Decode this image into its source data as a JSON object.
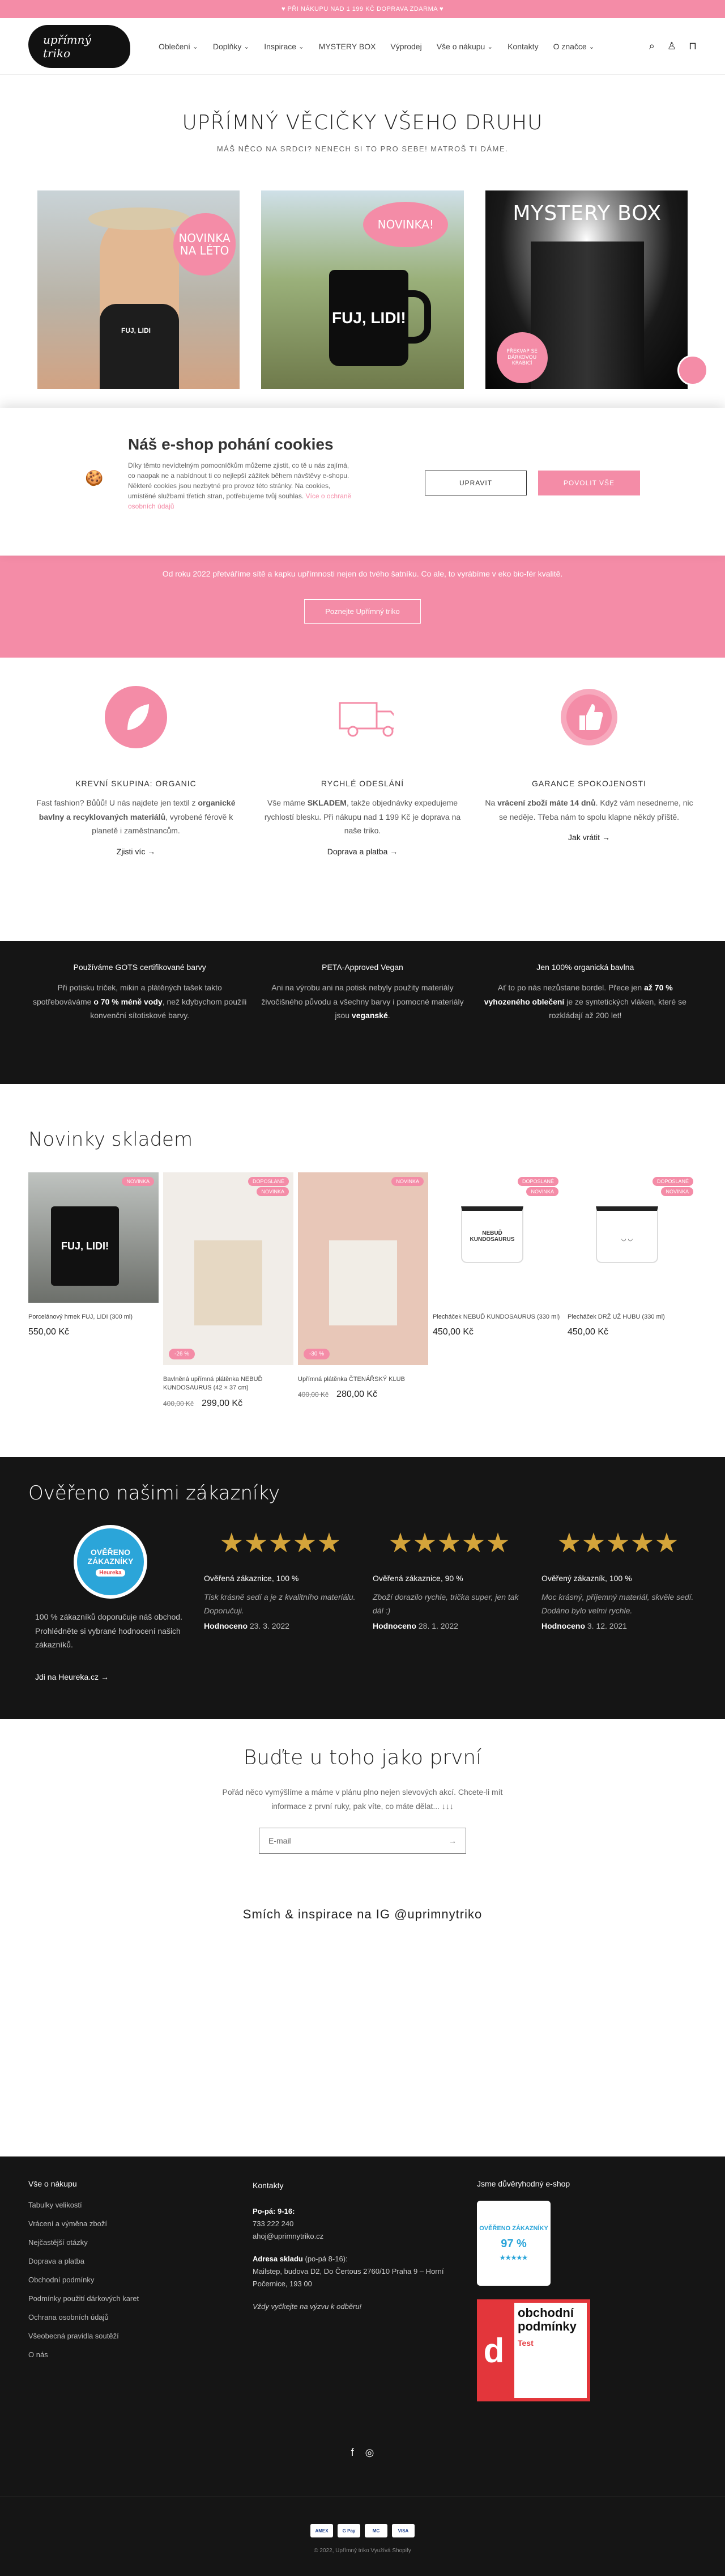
{
  "promo": "♥ PŘI NÁKUPU NAD 1 199 KČ DOPRAVA ZDARMA ♥",
  "header": {
    "logo": "upřímný triko",
    "nav": [
      "Oblečení",
      "Doplňky",
      "Inspirace",
      "MYSTERY BOX",
      "Výprodej",
      "Vše o nákupu",
      "Kontakty",
      "O značce"
    ],
    "nav_dropdown": [
      true,
      true,
      true,
      false,
      false,
      true,
      false,
      true
    ]
  },
  "hero": {
    "title": "UPŘÍMNÝ VĚCIČKY VŠEHO DRUHU",
    "subtitle": "MÁŠ NĚCO NA SRDCI? NENECH SI TO PRO SEBE! MATROŠ TI DÁME.",
    "cards": [
      {
        "badge": "NOVINKA NA LÉTO",
        "shirt_text": "FUJ, LIDI"
      },
      {
        "badge": "NOVINKA!",
        "mug_text": "FUJ, LIDI!"
      },
      {
        "title": "MYSTERY BOX",
        "badge": "PŘEKVAP SE DÁRKOVOU KRABICÍ"
      }
    ]
  },
  "cookie": {
    "title": "Náš e-shop pohání cookies",
    "text": "Díky těmto nevídtelným pomocníčkům můžeme zjistit, co tě u nás zajímá, co naopak ne a nabídnout ti co nejlepší zážitek během návštěvy e-shopu. Některé cookies jsou nezbytné pro provoz této stránky. Na cookies, umístěné službami třetích stran, potřebujeme tvůj souhlas.",
    "link": "Více o ochraně osobních údajů",
    "btn_upravit": "UPRAVIT",
    "btn_povolit": "POVOLIT VŠE"
  },
  "pinkband": {
    "text": "Od roku 2022 přetváříme sítě a kapku upřímnosti nejen do tvého šatníku. Co ale, to vyrábíme v eko bio-fér kvalitě.",
    "button": "Poznejte Upřímný triko"
  },
  "features": [
    {
      "title": "KREVNÍ SKUPINA: ORGANIC",
      "text_a": "Fast fashion? Bůůů! U nás najdete jen textil z ",
      "text_b": "organické bavlny a recyklovaných materiálů",
      "text_c": ", vyrobené férově k planetě i zaměstnancům.",
      "link": "Zjisti víc"
    },
    {
      "title": "RYCHLÉ ODESLÁNÍ",
      "text_a": "Vše máme ",
      "text_b": "SKLADEM",
      "text_c": ", takže objednávky expedujeme rychlostí blesku. Při nákupu nad 1 199 Kč je doprava na naše triko.",
      "link": "Doprava a platba"
    },
    {
      "title": "GARANCE SPOKOJENOSTI",
      "text_a": "Na ",
      "text_b": "vrácení zboží máte 14 dnů",
      "text_c": ". Když vám nesedneme, nic se neděje. Třeba nám to spolu klapne někdy příště.",
      "link": "Jak vrátit"
    }
  ],
  "values": [
    {
      "title": "Používáme GOTS certifikované barvy",
      "text_a": "Při potisku triček, mikin a plátěných tašek takto spotřebováváme ",
      "text_b": "o 70 % méně vody",
      "text_c": ", než kdybychom použili konvenční sítotiskové barvy."
    },
    {
      "title": "PETA-Approved Vegan",
      "text_a": "Ani na výrobu ani na potisk nebyly použity materiály živočišného původu a všechny barvy i pomocné materiály jsou ",
      "text_b": "veganské",
      "text_c": "."
    },
    {
      "title": "Jen 100% organická bavlna",
      "text_a": "Ať to po nás nezůstane bordel. Přece jen ",
      "text_b": "až 70 % vyhozeného oblečení",
      "text_c": " je ze syntetických vláken, které se rozkládají až 200 let!"
    }
  ],
  "new_section": {
    "title": "Novinky skladem",
    "products": [
      {
        "tags": [
          "NOVINKA"
        ],
        "name": "Porcelánový hrnek FUJ, LIDI (300 ml)",
        "price": "550,00 Kč",
        "old": "",
        "disc": ""
      },
      {
        "tags": [
          "DOPOSLANÉ",
          "NOVINKA"
        ],
        "name": "Bavlněná upřímná plátěnka NEBUĎ KUNDOSAURUS (42 × 37 cm)",
        "price": "299,00 Kč",
        "old": "400,00 Kč",
        "disc": "-26 %"
      },
      {
        "tags": [
          "NOVINKA"
        ],
        "name": "Upřímná plátěnka ČTENÁŘSKÝ KLUB",
        "price": "280,00 Kč",
        "old": "400,00 Kč",
        "disc": "-30 %"
      },
      {
        "tags": [
          "DOPOSLANÉ",
          "NOVINKA"
        ],
        "name": "Plecháček NEBUĎ KUNDOSAURUS (330 ml)",
        "price": "450,00 Kč",
        "old": "",
        "disc": ""
      },
      {
        "tags": [
          "DOPOSLANÉ",
          "NOVINKA"
        ],
        "name": "Plecháček DRŽ UŽ HUBU (330 ml)",
        "price": "450,00 Kč",
        "old": "",
        "disc": ""
      }
    ]
  },
  "reviews": {
    "title": "Ověřeno našimi zákazníky",
    "heureka_label": "OVĚŘENO ZÁKAZNÍKY",
    "heureka_brand": "Heureka",
    "summary": "100 % zákazníků doporučuje náš obchod. Prohlédněte si vybrané hodnocení našich zákazníků.",
    "link": "Jdi na Heureka.cz",
    "items": [
      {
        "head": "Ověřená zákaznice, 100 %",
        "text": "Tisk krásně sedí a je z kvalitního materiálu. Doporučuji.",
        "label": "Hodnoceno",
        "date": "23. 3. 2022"
      },
      {
        "head": "Ověřená zákaznice, 90 %",
        "text": "Zboží dorazilo rychle, trička super, jen tak dál :)",
        "label": "Hodnoceno",
        "date": "28. 1. 2022"
      },
      {
        "head": "Ověřený zákazník, 100 %",
        "text": "Moc krásný, příjemný materiál, skvěle sedí. Dodáno bylo velmi rychle.",
        "label": "Hodnoceno",
        "date": "3. 12. 2021"
      }
    ]
  },
  "newsletter": {
    "title": "Buďte u toho jako první",
    "text": "Pořád něco vymýšlíme a máme v plánu plno nejen slevových akcí. Chcete-li mít informace z první ruky, pak víte, co máte dělat... ↓↓↓",
    "placeholder": "E-mail"
  },
  "ig": "Smích & inspirace na IG @uprimnytriko",
  "footer": {
    "col1_title": "Vše o nákupu",
    "col1": [
      "Tabulky velikostí",
      "Vrácení a výměna zboží",
      "Nejčastější otázky",
      "Doprava a platba",
      "Obchodní podmínky",
      "Podmínky použití dárkových karet",
      "Ochrana osobních údajů",
      "Všeobecná pravidla soutěží",
      "O nás"
    ],
    "col2_title": "Kontakty",
    "hours_label": "Po-pá: 9-16:",
    "phone": "733 222 240",
    "email": "ahoj@uprimnytriko.cz",
    "address_label": "Adresa skladu",
    "address_hours": " (po-pá 8-16):",
    "address": "Mailstep, budova D2, Do Čertous 2760/10 Praha 9 – Horní Počernice, 193 00",
    "pickup": "Vždy vyčkejte na výzvu k odběru!",
    "col3_title": "Jsme důvěryhodný e-shop",
    "badge_top": "OVĚŘENO ZÁKAZNÍKY",
    "badge_pct": "97 %",
    "dtest_letter": "d",
    "dtest_word": "Test",
    "dtest_text": "obchodní podmínky",
    "copyright": "© 2022, Upřímný triko Využívá Shopify",
    "payments": [
      "AMEX",
      "G Pay",
      "MC",
      "VISA"
    ]
  }
}
